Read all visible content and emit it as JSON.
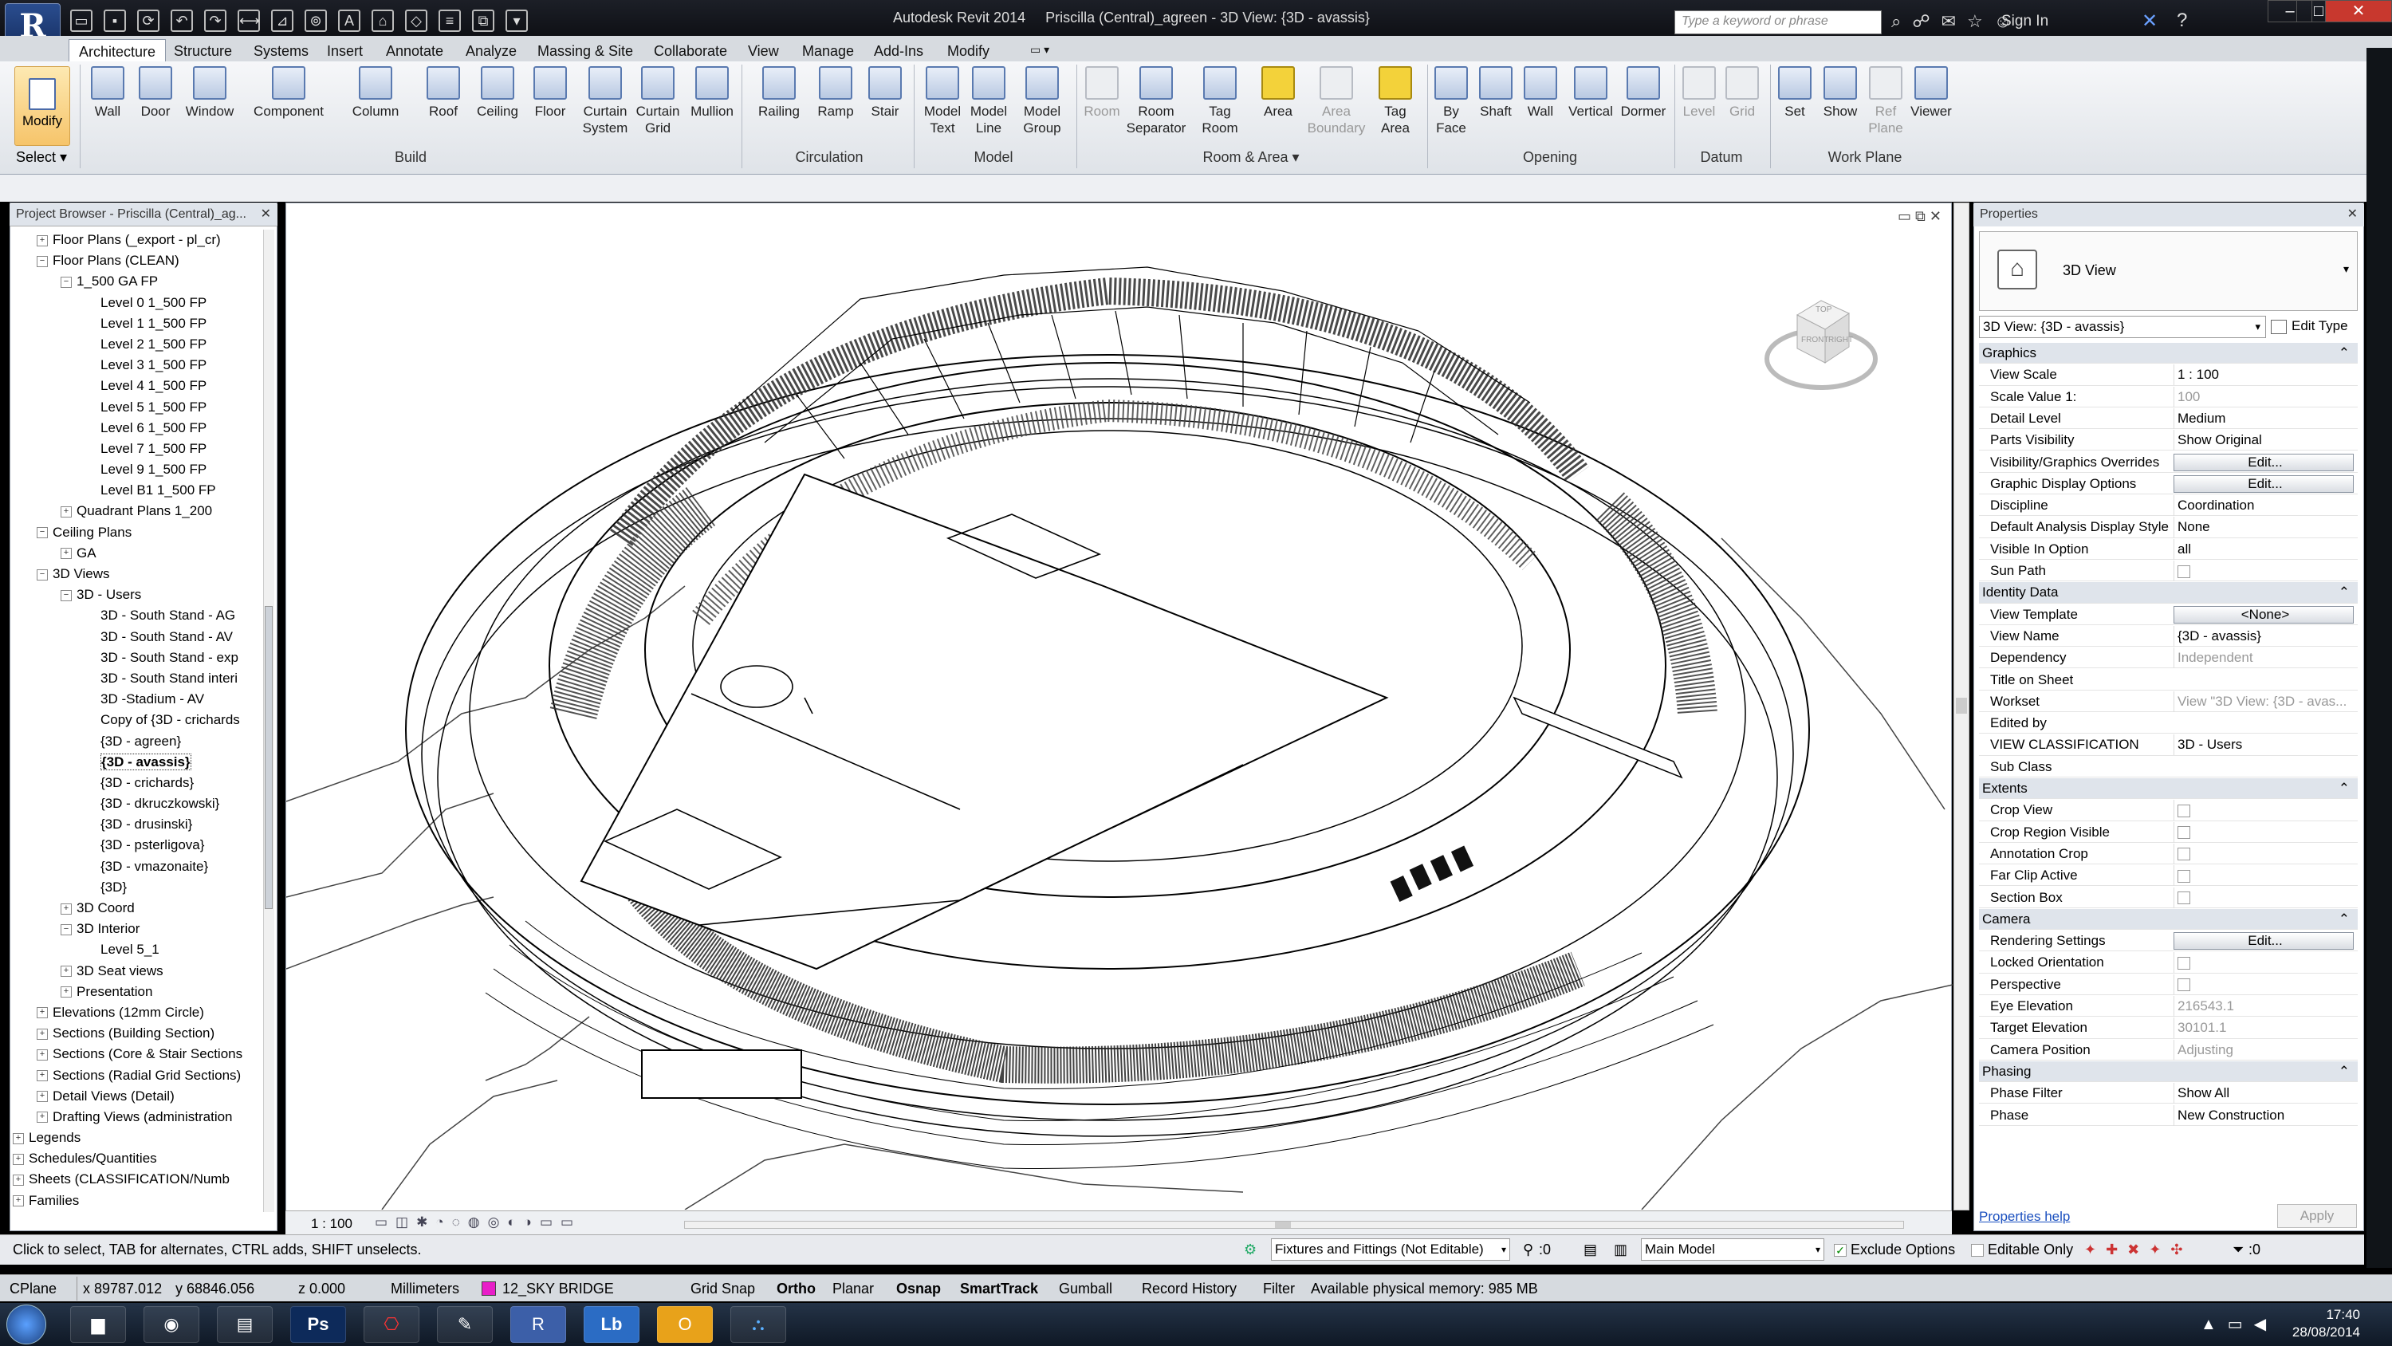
{
  "window": {
    "app_button": "R",
    "title": "Autodesk Revit 2014     Priscilla (Central)_agreen - 3D View: {3D - avassis}",
    "search_placeholder": "Type a keyword or phrase",
    "sign_in": "Sign In",
    "controls": [
      "–",
      "□",
      "✕"
    ]
  },
  "ribbon_tabs": [
    "Architecture",
    "Structure",
    "Systems",
    "Insert",
    "Annotate",
    "Analyze",
    "Massing & Site",
    "Collaborate",
    "View",
    "Manage",
    "Add-Ins",
    "Modify"
  ],
  "ribbon": {
    "modify": "Modify",
    "select_panel": "Select ▾",
    "build": [
      "Wall",
      "Door",
      "Window",
      "Component",
      "Column",
      "Roof",
      "Ceiling",
      "Floor",
      "Curtain System",
      "Curtain Grid",
      "Mullion"
    ],
    "build_label": "Build",
    "circulation": [
      "Railing",
      "Ramp",
      "Stair"
    ],
    "circulation_label": "Circulation",
    "model": [
      "Model Text",
      "Model Line",
      "Model Group"
    ],
    "model_label": "Model",
    "room": [
      "Room",
      "Room Separator",
      "Tag Room",
      "Area",
      "Area Boundary",
      "Tag Area"
    ],
    "room_label": "Room & Area ▾",
    "opening": [
      "By Face",
      "Shaft",
      "Wall",
      "Vertical",
      "Dormer"
    ],
    "opening_label": "Opening",
    "datum": [
      "Level",
      "Grid"
    ],
    "datum_label": "Datum",
    "workplane": [
      "Set",
      "Show",
      "Ref Plane",
      "Viewer"
    ],
    "workplane_label": "Work Plane"
  },
  "project_browser": {
    "header": "Project Browser - Priscilla (Central)_ag...",
    "items": [
      {
        "label": "Floor Plans (_export - pl_cr)",
        "indent": 1,
        "toggle": "+"
      },
      {
        "label": "Floor Plans (CLEAN)",
        "indent": 1,
        "toggle": "−"
      },
      {
        "label": "1_500 GA FP",
        "indent": 2,
        "toggle": "−"
      },
      {
        "label": "Level 0 1_500 FP",
        "indent": 3,
        "toggle": ""
      },
      {
        "label": "Level 1 1_500 FP",
        "indent": 3,
        "toggle": ""
      },
      {
        "label": "Level 2 1_500 FP",
        "indent": 3,
        "toggle": ""
      },
      {
        "label": "Level 3 1_500 FP",
        "indent": 3,
        "toggle": ""
      },
      {
        "label": "Level 4 1_500 FP",
        "indent": 3,
        "toggle": ""
      },
      {
        "label": "Level 5 1_500 FP",
        "indent": 3,
        "toggle": ""
      },
      {
        "label": "Level 6 1_500 FP",
        "indent": 3,
        "toggle": ""
      },
      {
        "label": "Level 7 1_500 FP",
        "indent": 3,
        "toggle": ""
      },
      {
        "label": "Level 9 1_500 FP",
        "indent": 3,
        "toggle": ""
      },
      {
        "label": "Level B1 1_500 FP",
        "indent": 3,
        "toggle": ""
      },
      {
        "label": "Quadrant Plans 1_200",
        "indent": 2,
        "toggle": "+"
      },
      {
        "label": "Ceiling Plans",
        "indent": 1,
        "toggle": "−"
      },
      {
        "label": "GA",
        "indent": 2,
        "toggle": "+"
      },
      {
        "label": "3D Views",
        "indent": 1,
        "toggle": "−"
      },
      {
        "label": "3D - Users",
        "indent": 2,
        "toggle": "−"
      },
      {
        "label": "3D - South Stand - AG",
        "indent": 3,
        "toggle": ""
      },
      {
        "label": "3D - South Stand - AV",
        "indent": 3,
        "toggle": ""
      },
      {
        "label": "3D - South Stand - exp",
        "indent": 3,
        "toggle": ""
      },
      {
        "label": "3D - South Stand interi",
        "indent": 3,
        "toggle": ""
      },
      {
        "label": "3D -Stadium - AV",
        "indent": 3,
        "toggle": ""
      },
      {
        "label": "Copy of {3D - crichards",
        "indent": 3,
        "toggle": ""
      },
      {
        "label": "{3D - agreen}",
        "indent": 3,
        "toggle": ""
      },
      {
        "label": "{3D - avassis}",
        "indent": 3,
        "toggle": "",
        "selected": true
      },
      {
        "label": "{3D - crichards}",
        "indent": 3,
        "toggle": ""
      },
      {
        "label": "{3D - dkruczkowski}",
        "indent": 3,
        "toggle": ""
      },
      {
        "label": "{3D - drusinski}",
        "indent": 3,
        "toggle": ""
      },
      {
        "label": "{3D - psterligova}",
        "indent": 3,
        "toggle": ""
      },
      {
        "label": "{3D - vmazonaite}",
        "indent": 3,
        "toggle": ""
      },
      {
        "label": "{3D}",
        "indent": 3,
        "toggle": ""
      },
      {
        "label": "3D Coord",
        "indent": 2,
        "toggle": "+"
      },
      {
        "label": "3D Interior",
        "indent": 2,
        "toggle": "−"
      },
      {
        "label": "Level 5_1",
        "indent": 3,
        "toggle": ""
      },
      {
        "label": "3D Seat views",
        "indent": 2,
        "toggle": "+"
      },
      {
        "label": "Presentation",
        "indent": 2,
        "toggle": "+"
      },
      {
        "label": "Elevations (12mm Circle)",
        "indent": 1,
        "toggle": "+"
      },
      {
        "label": "Sections (Building Section)",
        "indent": 1,
        "toggle": "+"
      },
      {
        "label": "Sections (Core & Stair Sections",
        "indent": 1,
        "toggle": "+"
      },
      {
        "label": "Sections (Radial Grid Sections)",
        "indent": 1,
        "toggle": "+"
      },
      {
        "label": "Detail Views (Detail)",
        "indent": 1,
        "toggle": "+"
      },
      {
        "label": "Drafting Views (administration",
        "indent": 1,
        "toggle": "+"
      },
      {
        "label": "Legends",
        "indent": 0,
        "toggle": "+"
      },
      {
        "label": "Schedules/Quantities",
        "indent": 0,
        "toggle": "+"
      },
      {
        "label": "Sheets (CLASSIFICATION/Numb",
        "indent": 0,
        "toggle": "+"
      },
      {
        "label": "Families",
        "indent": 0,
        "toggle": "+"
      }
    ]
  },
  "view": {
    "scale": "1 : 100",
    "viewcube_top": "TOP",
    "viewcube_front": "FRONT",
    "viewcube_right": "RIGHT"
  },
  "properties": {
    "header": "Properties",
    "type_name": "3D View",
    "instance_select": "3D View: {3D - avassis}",
    "edit_type": "Edit Type",
    "rows": [
      {
        "k": "Graphics",
        "group": true
      },
      {
        "k": "View Scale",
        "v": "1 : 100"
      },
      {
        "k": "Scale Value    1:",
        "v": "100",
        "dim": true
      },
      {
        "k": "Detail Level",
        "v": "Medium"
      },
      {
        "k": "Parts Visibility",
        "v": "Show Original"
      },
      {
        "k": "Visibility/Graphics Overrides",
        "v": "Edit...",
        "btn": true
      },
      {
        "k": "Graphic Display Options",
        "v": "Edit...",
        "btn": true
      },
      {
        "k": "Discipline",
        "v": "Coordination"
      },
      {
        "k": "Default Analysis Display Style",
        "v": "None"
      },
      {
        "k": "Visible In Option",
        "v": "all"
      },
      {
        "k": "Sun Path",
        "v": "",
        "chk": true
      },
      {
        "k": "Identity Data",
        "group": true
      },
      {
        "k": "View Template",
        "v": "<None>",
        "btn": true
      },
      {
        "k": "View Name",
        "v": "{3D - avassis}"
      },
      {
        "k": "Dependency",
        "v": "Independent",
        "dim": true
      },
      {
        "k": "Title on Sheet",
        "v": ""
      },
      {
        "k": "Workset",
        "v": "View \"3D View: {3D - avas...",
        "dim": true
      },
      {
        "k": "Edited by",
        "v": "",
        "dim": true
      },
      {
        "k": "VIEW CLASSIFICATION",
        "v": "3D - Users"
      },
      {
        "k": "Sub Class",
        "v": ""
      },
      {
        "k": "Extents",
        "group": true
      },
      {
        "k": "Crop View",
        "v": "",
        "chk": true
      },
      {
        "k": "Crop Region Visible",
        "v": "",
        "chk": true
      },
      {
        "k": "Annotation Crop",
        "v": "",
        "chk": true
      },
      {
        "k": "Far Clip Active",
        "v": "",
        "chk": true,
        "dim": true
      },
      {
        "k": "Section Box",
        "v": "",
        "chk": true
      },
      {
        "k": "Camera",
        "group": true
      },
      {
        "k": "Rendering Settings",
        "v": "Edit...",
        "btn": true
      },
      {
        "k": "Locked Orientation",
        "v": "",
        "chk": true,
        "dim": true
      },
      {
        "k": "Perspective",
        "v": "",
        "chk": true,
        "dim": true
      },
      {
        "k": "Eye Elevation",
        "v": "216543.1",
        "dim": true
      },
      {
        "k": "Target Elevation",
        "v": "30101.1",
        "dim": true
      },
      {
        "k": "Camera Position",
        "v": "Adjusting",
        "dim": true
      },
      {
        "k": "Phasing",
        "group": true
      },
      {
        "k": "Phase Filter",
        "v": "Show All"
      },
      {
        "k": "Phase",
        "v": "New Construction"
      }
    ],
    "help": "Properties help",
    "apply": "Apply"
  },
  "status": {
    "hint": "Click to select, TAB for alternates, CTRL adds, SHIFT unselects.",
    "workset": "Fixtures and Fittings (Not Editable)",
    "zero": ":0",
    "model": "Main Model",
    "exclude_options": "Exclude Options",
    "editable_only": "Editable Only",
    "filter_count": ":0"
  },
  "cmdbar": {
    "cplane": "CPlane",
    "x": "x 89787.012",
    "y": "y 68846.056",
    "z": "z 0.000",
    "units": "Millimeters",
    "layer": "12_SKY BRIDGE",
    "toggles": [
      "Grid Snap",
      "Ortho",
      "Planar",
      "Osnap",
      "SmartTrack",
      "Gumball",
      "Record History",
      "Filter"
    ],
    "memory": "Available physical memory: 985 MB"
  },
  "taskbar": {
    "time": "17:40",
    "date": "28/08/2014",
    "apps": [
      "Explorer",
      "Chrome",
      "Notepad",
      "Ps",
      "Acrobat",
      "Tools",
      "Revit",
      "LB",
      "Outlook",
      "Rhino"
    ]
  },
  "colors": {
    "accent": "#3a6fc4",
    "selected_tab": "#ffffff",
    "taskbar": "#1a2738"
  }
}
